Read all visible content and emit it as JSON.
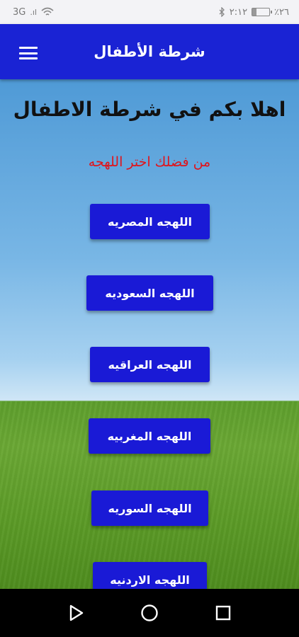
{
  "status_bar": {
    "network": "3G",
    "signal": ".ıl",
    "time": "٢:١٢",
    "battery_text": "٪٢٦",
    "battery_level": 0.26
  },
  "app_bar": {
    "title": "شرطة الأطفال",
    "menu_icon": "hamburger-menu-icon"
  },
  "main": {
    "welcome": "اهلا بكم في شرطة الاطفال",
    "prompt": "من فضلك اختر اللهجه",
    "buttons": [
      {
        "label": "اللهجه المصريه"
      },
      {
        "label": "اللهجه السعوديه"
      },
      {
        "label": "اللهجه العراقيه"
      },
      {
        "label": "اللهجه المغربيه"
      },
      {
        "label": "اللهجه السوريه"
      },
      {
        "label": "اللهجه الاردنيه"
      }
    ]
  },
  "nav_bar": {
    "back_icon": "back-triangle-icon",
    "home_icon": "home-circle-icon",
    "recents_icon": "recents-square-icon"
  },
  "colors": {
    "app_bar": "#1a23d4",
    "button": "#1a1ad6",
    "prompt": "#e0141b"
  }
}
